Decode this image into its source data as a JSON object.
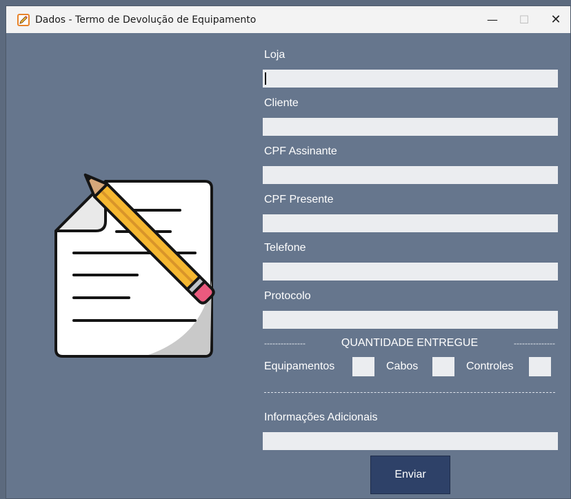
{
  "window": {
    "title": "Dados - Termo de Devolução de Equipamento",
    "controls": {
      "minimize": "—",
      "maximize": "☐",
      "close": "✕"
    }
  },
  "form": {
    "fields": [
      {
        "label": "Loja",
        "value": ""
      },
      {
        "label": "Cliente",
        "value": ""
      },
      {
        "label": "CPF Assinante",
        "value": ""
      },
      {
        "label": "CPF Presente",
        "value": ""
      },
      {
        "label": "Telefone",
        "value": ""
      },
      {
        "label": "Protocolo",
        "value": ""
      }
    ],
    "section_title": "QUANTIDADE ENTREGUE",
    "section_dashes_left": "---------------",
    "section_dashes_right": "---------------",
    "quantities": [
      {
        "label": "Equipamentos",
        "value": ""
      },
      {
        "label": "Cabos",
        "value": ""
      },
      {
        "label": "Controles",
        "value": ""
      }
    ],
    "extra": {
      "label": "Informações Adicionais",
      "value": ""
    },
    "submit_label": "Enviar"
  },
  "icons": {
    "app": "edit-document-icon",
    "illustration": "document-with-pencil-icon"
  },
  "colors": {
    "background": "#66768d",
    "titlebar": "#f3f3f3",
    "input": "#ebedf0",
    "button": "#2e4168"
  }
}
